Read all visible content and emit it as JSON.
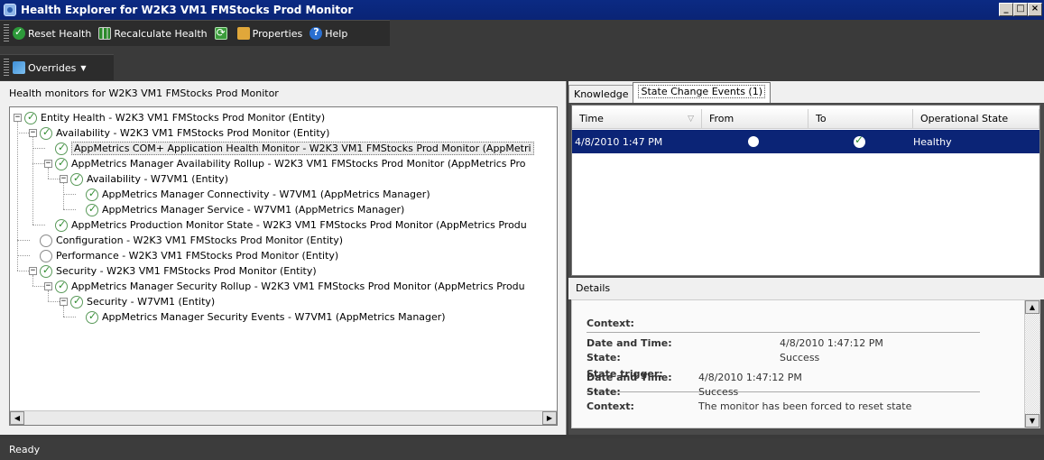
{
  "window": {
    "title": "Health Explorer for W2K3 VM1 FMStocks Prod Monitor",
    "controls": [
      "_",
      "□",
      "×"
    ]
  },
  "toolbar": {
    "reset_health": "Reset Health",
    "recalculate_health": "Recalculate Health",
    "properties": "Properties",
    "help": "Help",
    "overrides": "Overrides"
  },
  "left": {
    "header": "Health monitors for W2K3 VM1 FMStocks Prod Monitor",
    "tree": [
      {
        "label": "Entity Health - W2K3 VM1 FMStocks Prod Monitor (Entity)",
        "level": 0,
        "expander": "−",
        "state": "ok"
      },
      {
        "label": "Availability - W2K3 VM1 FMStocks Prod Monitor (Entity)",
        "level": 1,
        "expander": "−",
        "state": "ok"
      },
      {
        "label": "AppMetrics COM+ Application Health Monitor - W2K3 VM1 FMStocks Prod Monitor (AppMetri",
        "level": 2,
        "expander": "",
        "state": "ok",
        "selected": true
      },
      {
        "label": "AppMetrics Manager Availability Rollup - W2K3 VM1 FMStocks Prod Monitor (AppMetrics Pro",
        "level": 2,
        "expander": "−",
        "state": "ok"
      },
      {
        "label": "Availability - W7VM1 (Entity)",
        "level": 3,
        "expander": "−",
        "state": "ok"
      },
      {
        "label": "AppMetrics Manager Connectivity - W7VM1 (AppMetrics Manager)",
        "level": 4,
        "expander": "",
        "state": "ok"
      },
      {
        "label": "AppMetrics Manager Service - W7VM1 (AppMetrics Manager)",
        "level": 4,
        "expander": "",
        "state": "ok"
      },
      {
        "label": "AppMetrics Production Monitor State - W2K3 VM1 FMStocks Prod Monitor (AppMetrics Produ",
        "level": 2,
        "expander": "",
        "state": "ok"
      },
      {
        "label": "Configuration - W2K3 VM1 FMStocks Prod Monitor (Entity)",
        "level": 1,
        "expander": "",
        "state": "none"
      },
      {
        "label": "Performance - W2K3 VM1 FMStocks Prod Monitor (Entity)",
        "level": 1,
        "expander": "",
        "state": "none"
      },
      {
        "label": "Security - W2K3 VM1 FMStocks Prod Monitor (Entity)",
        "level": 1,
        "expander": "−",
        "state": "ok"
      },
      {
        "label": "AppMetrics Manager Security Rollup - W2K3 VM1 FMStocks Prod Monitor (AppMetrics Produ",
        "level": 2,
        "expander": "−",
        "state": "ok"
      },
      {
        "label": "Security - W7VM1 (Entity)",
        "level": 3,
        "expander": "−",
        "state": "ok"
      },
      {
        "label": "AppMetrics Manager Security Events - W7VM1 (AppMetrics Manager)",
        "level": 4,
        "expander": "",
        "state": "ok"
      }
    ]
  },
  "right": {
    "tabs": [
      "Knowledge",
      "State Change Events (1)"
    ],
    "active_tab": 1,
    "columns": [
      "Time",
      "From",
      "To",
      "Operational State"
    ],
    "rows": [
      {
        "time": "4/8/2010 1:47 PM",
        "from": "unknown",
        "to": "healthy",
        "state": "Healthy"
      }
    ],
    "details_label": "Details",
    "details": {
      "context_label": "Context:",
      "block1": {
        "date_label": "Date and Time:",
        "date_value": "4/8/2010 1:47:12 PM",
        "state_label": "State:",
        "state_value": "Success",
        "trigger_label": "State trigger:"
      },
      "block2": {
        "date_label": "Date and Time:",
        "date_value": "4/8/2010 1:47:12 PM",
        "state_label": "State:",
        "state_value": "Success",
        "context_label": "Context:",
        "context_value": "The monitor has been forced to reset state"
      }
    }
  },
  "status": {
    "text": "Ready"
  }
}
